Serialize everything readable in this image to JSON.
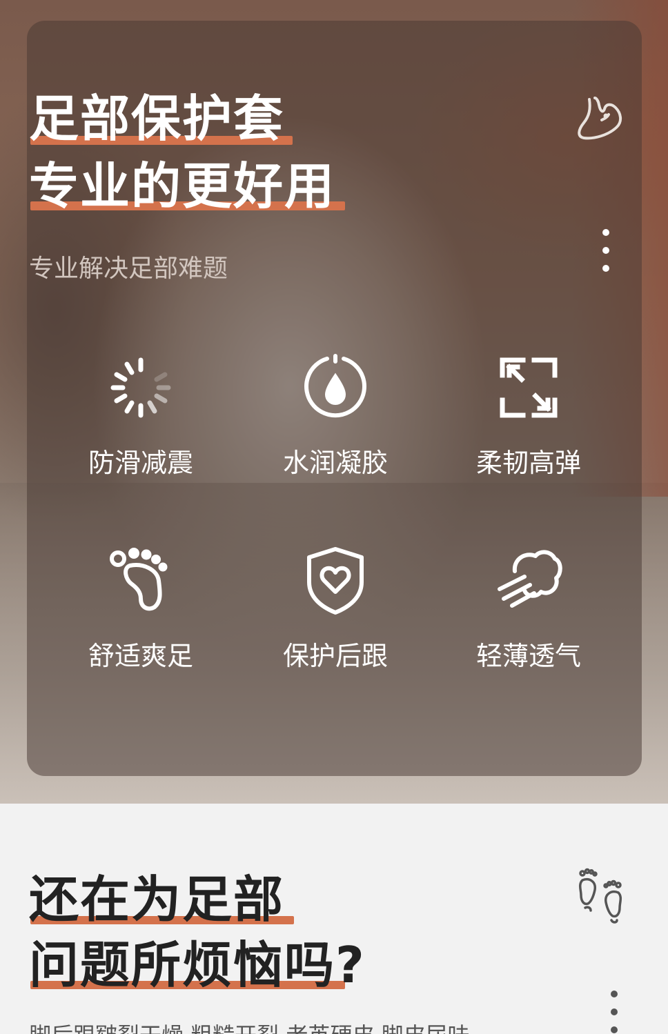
{
  "hero": {
    "title_line1": "足部保护套",
    "title_line2": "专业的更好用",
    "subtitle": "专业解决足部难题",
    "accent_color": "#d4724c",
    "features": [
      {
        "label": "防滑减震",
        "icon": "loading-spinner-icon"
      },
      {
        "label": "水润凝胶",
        "icon": "water-drop-icon"
      },
      {
        "label": "柔韧高弹",
        "icon": "expand-arrows-icon"
      },
      {
        "label": "舒适爽足",
        "icon": "footprint-icon"
      },
      {
        "label": "保护后跟",
        "icon": "shield-heart-icon"
      },
      {
        "label": "轻薄透气",
        "icon": "wind-cloud-icon"
      }
    ]
  },
  "problems": {
    "title_line1": "还在为足部",
    "title_line2": "问题所烦恼吗?",
    "cut_off_text": "脚后跟皲裂干燥 粗糙开裂 老茧硬皮 脚皮尿味"
  }
}
